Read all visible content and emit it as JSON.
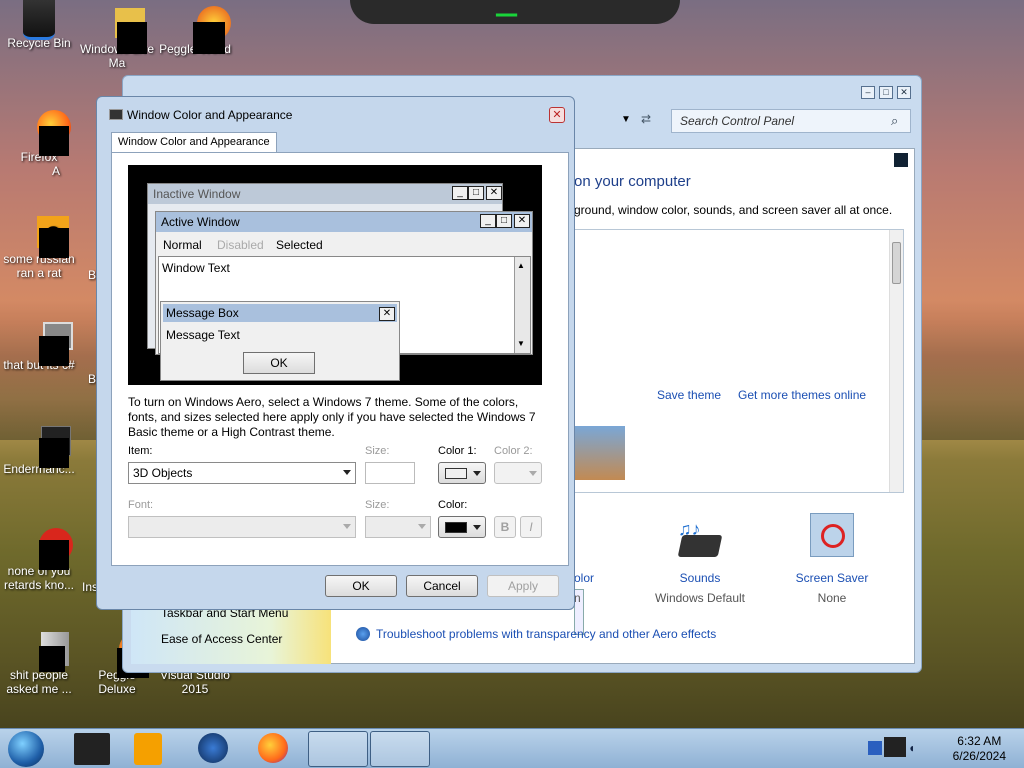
{
  "desktop": {
    "icons": [
      {
        "label": "Recycle Bin",
        "icon": "recycle-bin-icon"
      },
      {
        "label": "Windows Live Ma",
        "icon": "windows-live-icon"
      },
      {
        "label": "Peggle World",
        "icon": "peggle-icon"
      },
      {
        "label": "Firefox",
        "icon": "firefox-icon"
      },
      {
        "label": "some russian ran a rat",
        "icon": "file-icon"
      },
      {
        "label": "that but its c#",
        "icon": "stack-icon"
      },
      {
        "label": "Endermanc...",
        "icon": "app-icon"
      },
      {
        "label": "none of you retards kno...",
        "icon": "app-icon"
      },
      {
        "label": "shit people asked me ...",
        "icon": "folder-icon"
      },
      {
        "label": "Peggle Deluxe",
        "icon": "peggle-icon"
      },
      {
        "label": "Visual Studio 2015",
        "icon": "visual-studio-icon"
      }
    ],
    "partial_labels": [
      "A",
      "B",
      "B",
      "Ins"
    ]
  },
  "control_panel": {
    "search_placeholder": "Search Control Panel",
    "heading": "on your computer",
    "description": "ground, window color, sounds, and screen saver all at once.",
    "save_theme": "Save theme",
    "more_themes": "Get more themes online",
    "bottom_items": [
      {
        "label": "olor",
        "sub": "n"
      },
      {
        "label": "Sounds",
        "sub": "Windows Default"
      },
      {
        "label": "Screen Saver",
        "sub": "None"
      }
    ],
    "troubleshoot": "Troubleshoot problems with transparency and other Aero effects",
    "left_links": [
      "Taskbar and Start Menu",
      "Ease of Access Center"
    ]
  },
  "dialog": {
    "title": "Window Color and Appearance",
    "tab": "Window Color and Appearance",
    "preview": {
      "inactive": "Inactive Window",
      "active": "Active Window",
      "menu": [
        "Normal",
        "Disabled",
        "Selected"
      ],
      "window_text": "Window Text",
      "message_box": "Message Box",
      "message_text": "Message Text",
      "ok": "OK"
    },
    "info": "To turn on Windows Aero, select a Windows 7 theme.  Some of the colors, fonts, and sizes selected here apply only if you have selected the Windows 7 Basic theme or a High Contrast theme.",
    "item_label": "Item:",
    "item_value": "3D Objects",
    "size_label": "Size:",
    "color1_label": "Color 1:",
    "color2_label": "Color 2:",
    "font_label": "Font:",
    "size2_label": "Size:",
    "color_label": "Color:",
    "bold": "B",
    "italic": "I",
    "ok": "OK",
    "cancel": "Cancel",
    "apply": "Apply"
  },
  "taskbar": {
    "time": "6:32 AM",
    "date": "6/26/2024"
  }
}
